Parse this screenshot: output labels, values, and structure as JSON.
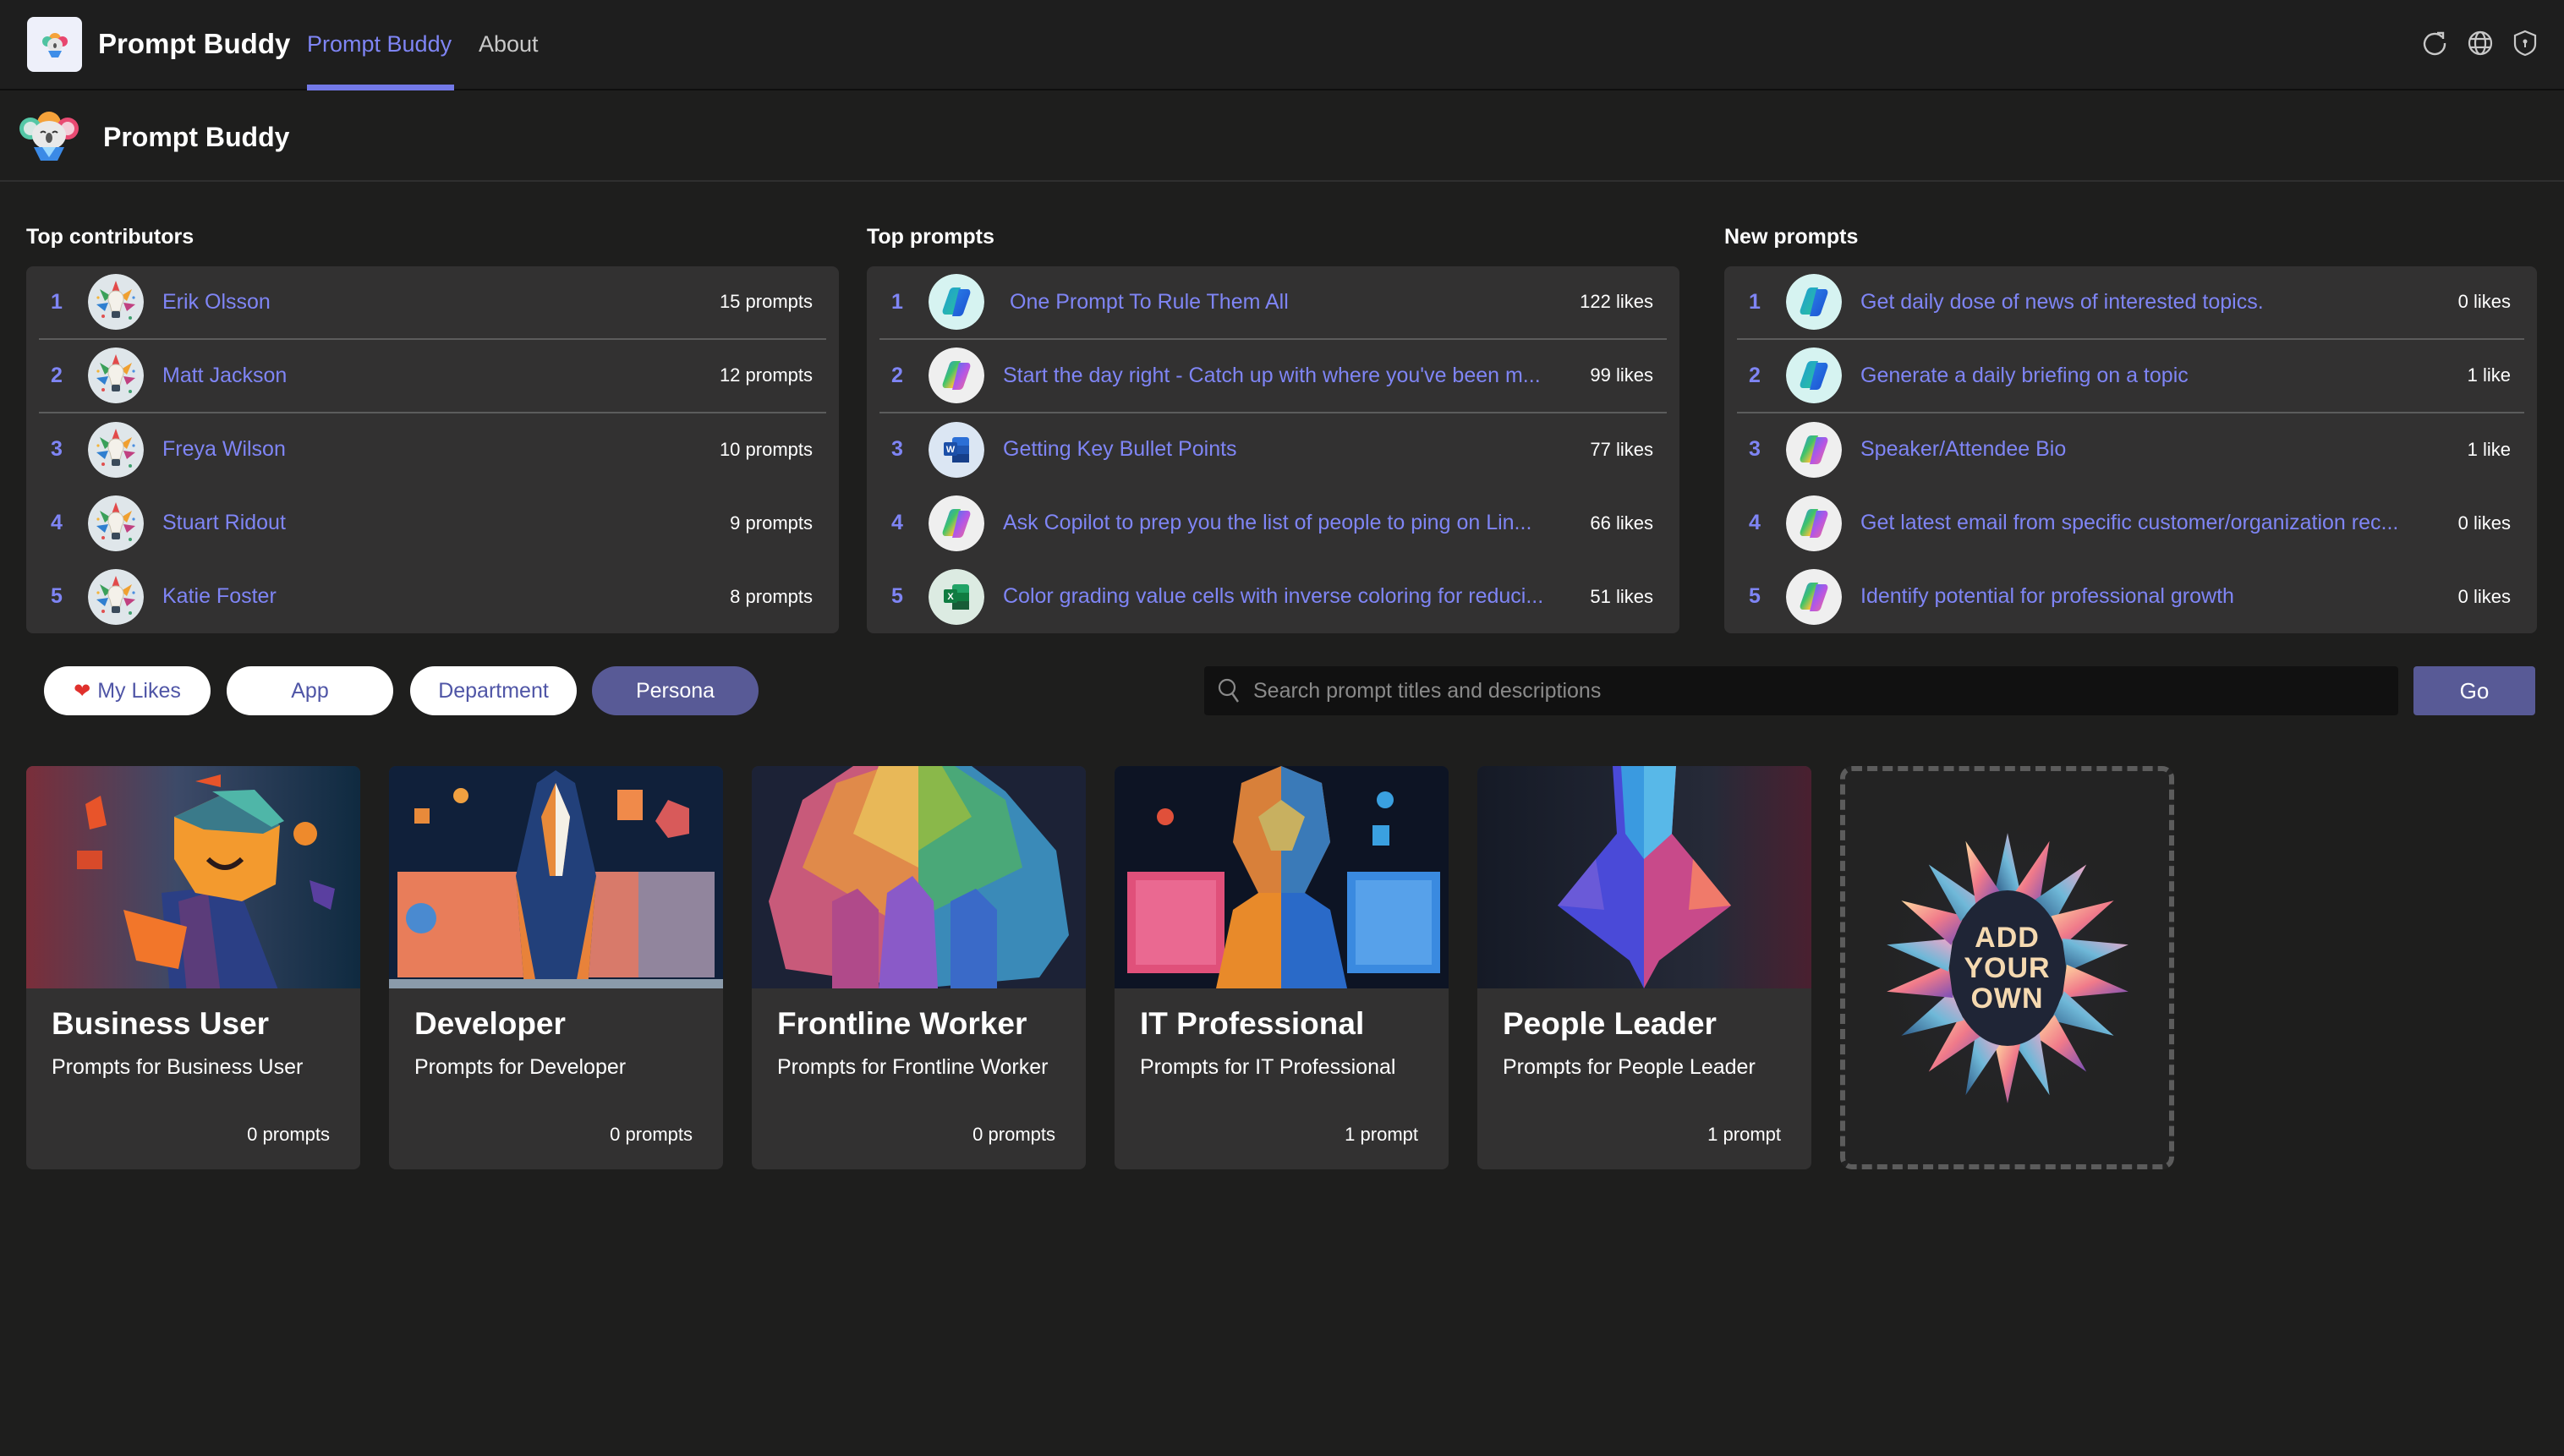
{
  "appbar": {
    "app_name": "Prompt Buddy",
    "tabs": [
      {
        "label": "Prompt Buddy",
        "active": true
      },
      {
        "label": "About",
        "active": false
      }
    ],
    "icons": [
      "refresh-icon",
      "globe-icon",
      "shield-icon"
    ]
  },
  "header": {
    "title": "Prompt Buddy",
    "logo": "koala-logo-icon"
  },
  "top_contributors": {
    "title": "Top contributors",
    "items": [
      {
        "rank": "1",
        "name": "Erik Olsson",
        "count": "15 prompts"
      },
      {
        "rank": "2",
        "name": "Matt Jackson",
        "count": "12 prompts"
      },
      {
        "rank": "3",
        "name": "Freya Wilson",
        "count": "10 prompts"
      },
      {
        "rank": "4",
        "name": "Stuart Ridout",
        "count": "9 prompts"
      },
      {
        "rank": "5",
        "name": "Katie Foster",
        "count": "8 prompts"
      }
    ]
  },
  "top_prompts": {
    "title": "Top prompts",
    "items": [
      {
        "rank": "1",
        "title": "One Prompt To Rule Them All",
        "likes": "122 likes",
        "app_icon": "copilot-icon"
      },
      {
        "rank": "2",
        "title": "Start the day right - Catch up with where you've been m...",
        "likes": "99 likes",
        "app_icon": "copilot-color-icon"
      },
      {
        "rank": "3",
        "title": "Getting Key Bullet Points",
        "likes": "77 likes",
        "app_icon": "word-icon"
      },
      {
        "rank": "4",
        "title": "Ask Copilot to prep you the list of people to ping on Lin...",
        "likes": "66 likes",
        "app_icon": "copilot-color-icon"
      },
      {
        "rank": "5",
        "title": "Color grading value cells with inverse coloring for reduci...",
        "likes": "51 likes",
        "app_icon": "excel-icon"
      }
    ]
  },
  "new_prompts": {
    "title": "New prompts",
    "items": [
      {
        "rank": "1",
        "title": "Get daily dose of news of interested topics.",
        "likes": "0 likes",
        "app_icon": "copilot-icon"
      },
      {
        "rank": "2",
        "title": "Generate a daily briefing on a topic",
        "likes": "1 like",
        "app_icon": "copilot-icon"
      },
      {
        "rank": "3",
        "title": "Speaker/Attendee Bio",
        "likes": "1 like",
        "app_icon": "copilot-color-icon"
      },
      {
        "rank": "4",
        "title": "Get latest email from specific customer/organization rec...",
        "likes": "0 likes",
        "app_icon": "copilot-color-icon"
      },
      {
        "rank": "5",
        "title": "Identify potential for professional growth",
        "likes": "0 likes",
        "app_icon": "copilot-color-icon"
      }
    ]
  },
  "filters": {
    "pills": [
      {
        "label": "My Likes",
        "icon": "heart-icon",
        "active": false
      },
      {
        "label": "App",
        "active": false
      },
      {
        "label": "Department",
        "active": false
      },
      {
        "label": "Persona",
        "active": true
      }
    ],
    "search_placeholder": "Search prompt titles and descriptions",
    "search_value": "",
    "go_label": "Go"
  },
  "personas": [
    {
      "title": "Business User",
      "description": "Prompts for Business User",
      "count": "0 prompts"
    },
    {
      "title": "Developer",
      "description": "Prompts for Developer",
      "count": "0 prompts"
    },
    {
      "title": "Frontline Worker",
      "description": "Prompts for Frontline Worker",
      "count": "0 prompts"
    },
    {
      "title": "IT Professional",
      "description": "Prompts for IT Professional",
      "count": "1 prompt"
    },
    {
      "title": "People Leader",
      "description": "Prompts for People Leader",
      "count": "1 prompt"
    }
  ],
  "add_own": {
    "line1": "ADD",
    "line2": "YOUR",
    "line3": "OWN"
  },
  "colors": {
    "accent": "#7f85f5",
    "button": "#585a96",
    "panel": "#323131",
    "background": "#1e1e1d"
  }
}
